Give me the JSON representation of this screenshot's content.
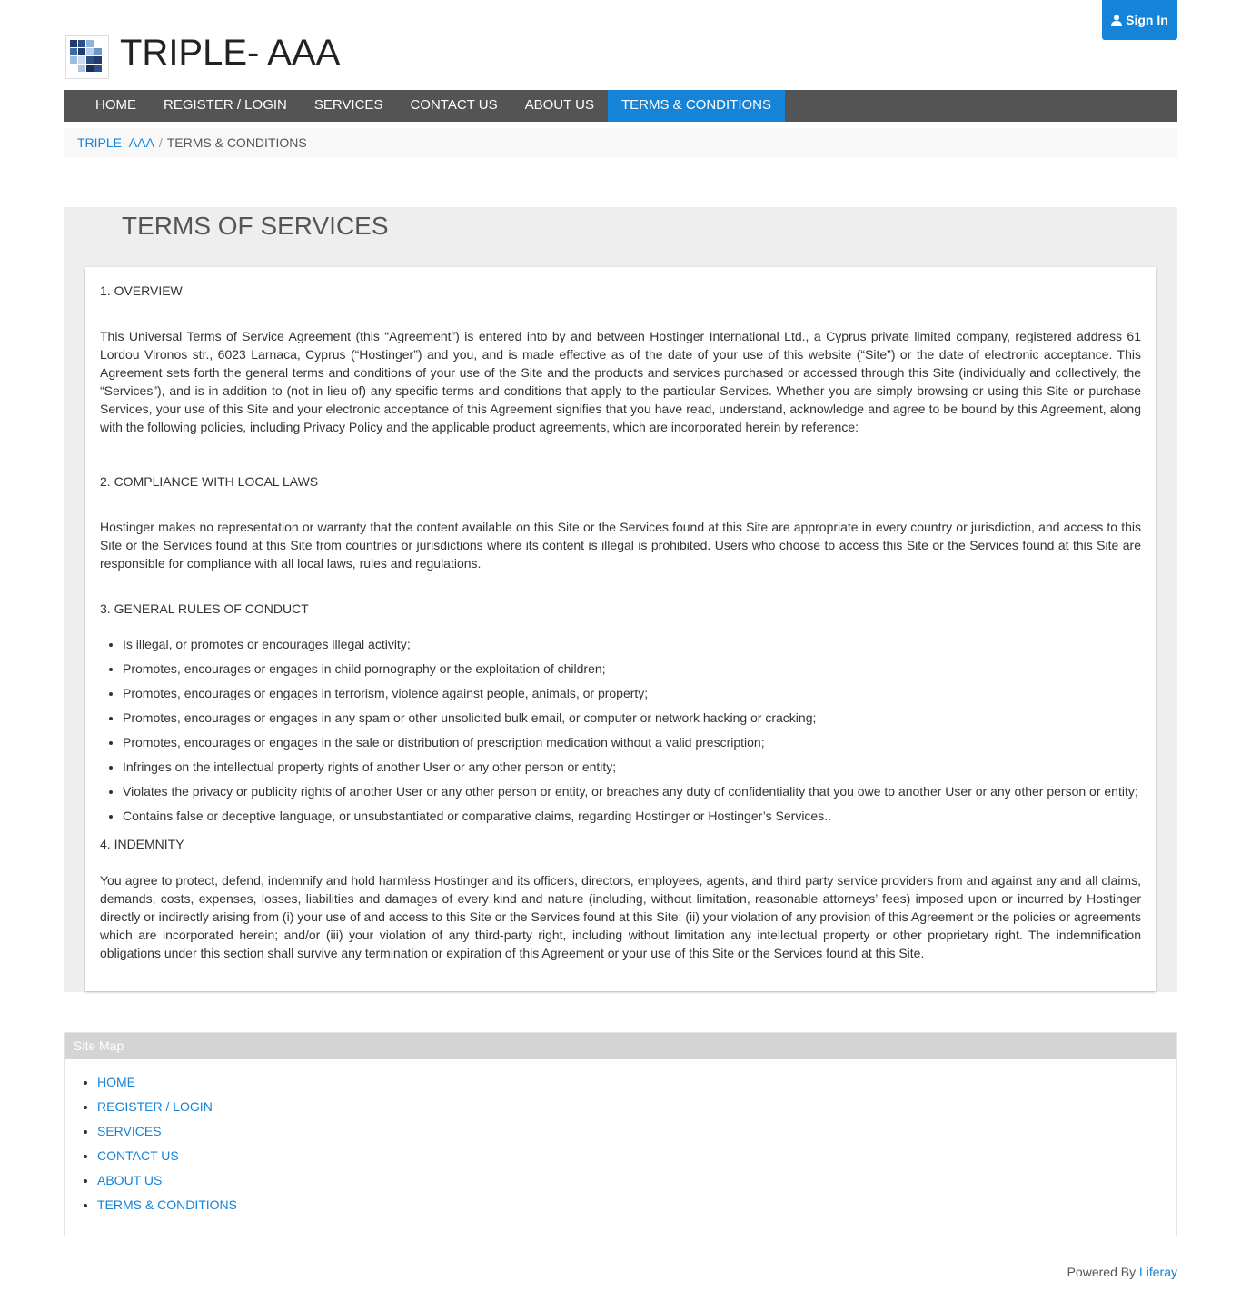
{
  "header": {
    "signin_label": "Sign In",
    "site_title": "TRIPLE- AAA",
    "logo_icon": "logo-mosaic-icon",
    "user_icon": "user-icon"
  },
  "nav": {
    "items": [
      {
        "label": "HOME"
      },
      {
        "label": "REGISTER / LOGIN"
      },
      {
        "label": "SERVICES"
      },
      {
        "label": "CONTACT US"
      },
      {
        "label": "ABOUT US"
      },
      {
        "label": "TERMS & CONDITIONS",
        "active": true
      }
    ]
  },
  "breadcrumb": {
    "root": "TRIPLE- AAA",
    "separator": "/",
    "current": "TERMS & CONDITIONS"
  },
  "main": {
    "title": "TERMS OF SERVICES",
    "sections": [
      {
        "heading": "1. OVERVIEW",
        "body": "This Universal Terms of Service Agreement (this “Agreement”) is entered into by and between Hostinger International Ltd., a Cyprus private limited company, registered address 61 Lordou Vironos str., 6023 Larnaca, Cyprus (“Hostinger”) and you, and is made effective as of the date of your use of this website (“Site”) or the date of electronic acceptance. This Agreement sets forth the general terms and conditions of your use of the Site and the products and services purchased or accessed through this Site (individually and collectively, the “Services”), and is in addition to (not in lieu of) any specific terms and conditions that apply to the particular Services. Whether you are simply browsing or using this Site or purchase Services, your use of this Site and your electronic acceptance of this Agreement signifies that you have read, understand, acknowledge and agree to be bound by this Agreement, along with the following policies, including Privacy Policy and the applicable product agreements, which are incorporated herein by reference:"
      },
      {
        "heading": "2. COMPLIANCE WITH LOCAL LAWS",
        "body": "Hostinger makes no representation or warranty that the content available on this Site or the Services found at this Site are appropriate in every country or jurisdiction, and access to this Site or the Services found at this Site from countries or jurisdictions where its content is illegal is prohibited. Users who choose to access this Site or the Services found at this Site are responsible for compliance with all local laws, rules and regulations."
      },
      {
        "heading": "3. GENERAL RULES OF CONDUCT",
        "items": [
          "Is illegal, or promotes or encourages illegal activity;",
          "Promotes, encourages or engages in child pornography or the exploitation of children;",
          "Promotes, encourages or engages in terrorism, violence against people, animals, or property;",
          "Promotes, encourages or engages in any spam or other unsolicited bulk email, or computer or network hacking or cracking;",
          "Promotes, encourages or engages in the sale or distribution of prescription medication without a valid prescription;",
          "Infringes on the intellectual property rights of another User or any other person or entity;",
          "Violates the privacy or publicity rights of another User or any other person or entity, or breaches any duty of confidentiality that you owe to another User or any other person or entity;",
          "Contains false or deceptive language, or unsubstantiated or comparative claims, regarding Hostinger or Hostinger’s Services.."
        ]
      },
      {
        "heading": "4. INDEMNITY",
        "body": "You agree to protect, defend, indemnify and hold harmless Hostinger and its officers, directors, employees, agents, and third party service providers from and against any and all claims, demands, costs, expenses, losses, liabilities and damages of every kind and nature (including, without limitation, reasonable attorneys’ fees) imposed upon or incurred by Hostinger directly or indirectly arising from (i) your use of and access to this Site or the Services found at this Site; (ii) your violation of any provision of this Agreement or the policies or agreements which are incorporated herein; and/or (iii) your violation of any third-party right, including without limitation any intellectual property or other proprietary right. The indemnification obligations under this section shall survive any termination or expiration of this Agreement or your use of this Site or the Services found at this Site."
      }
    ]
  },
  "sitemap": {
    "title": "Site Map",
    "links": [
      "HOME",
      "REGISTER / LOGIN",
      "SERVICES",
      "CONTACT US",
      "ABOUT US",
      "TERMS & CONDITIONS"
    ]
  },
  "footer": {
    "powered_by": "Powered By",
    "liferay": "Liferay"
  },
  "colors": {
    "accent": "#1583d8",
    "nav_bg": "#545454",
    "portlet_bg": "#eeeeee",
    "sitemap_header_bg": "#d4d4d4"
  }
}
